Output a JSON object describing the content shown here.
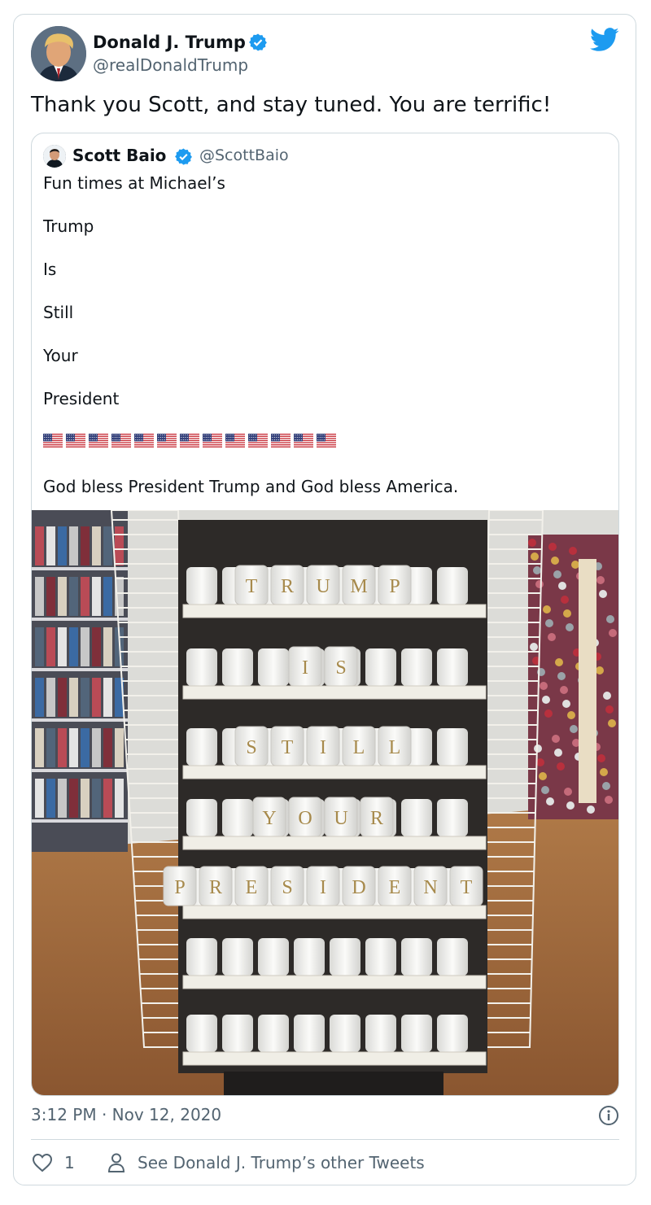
{
  "tweet": {
    "author_name": "Donald J. Trump",
    "author_handle": "@realDonaldTrump",
    "text": "Thank you Scott, and stay tuned. You are terrific!",
    "timestamp": "3:12 PM · Nov 12, 2020",
    "like_count": "1",
    "see_others_label": "See Donald J. Trump’s other Tweets"
  },
  "quoted_tweet": {
    "author_name": "Scott Baio",
    "author_handle": "@ScottBaio",
    "lines": [
      "Fun times at Michael’s",
      "Trump",
      "Is",
      "Still",
      "Your",
      "President"
    ],
    "flag_count": 13,
    "closing_line": "God bless President Trump and God bless America.",
    "photo": {
      "shelves": [
        {
          "letters": [
            "T",
            "R",
            "U",
            "M",
            "P"
          ]
        },
        {
          "letters": [
            "I",
            "S"
          ]
        },
        {
          "letters": [
            "S",
            "T",
            "I",
            "L",
            "L"
          ]
        },
        {
          "letters": [
            "Y",
            "O",
            "U",
            "R"
          ]
        },
        {
          "letters": [
            "P",
            "R",
            "E",
            "S",
            "I",
            "D",
            "E",
            "N",
            "T"
          ]
        },
        {
          "letters": []
        },
        {
          "letters": []
        }
      ]
    }
  },
  "icons": {
    "verified": "verified-badge-icon",
    "brand": "twitter-bird-icon",
    "info": "info-icon",
    "like": "heart-icon",
    "profile": "person-icon"
  },
  "colors": {
    "verified": "#1d9bf0",
    "brand": "#1d9bf0",
    "secondary_text": "#536471",
    "border": "#cfd9de"
  }
}
